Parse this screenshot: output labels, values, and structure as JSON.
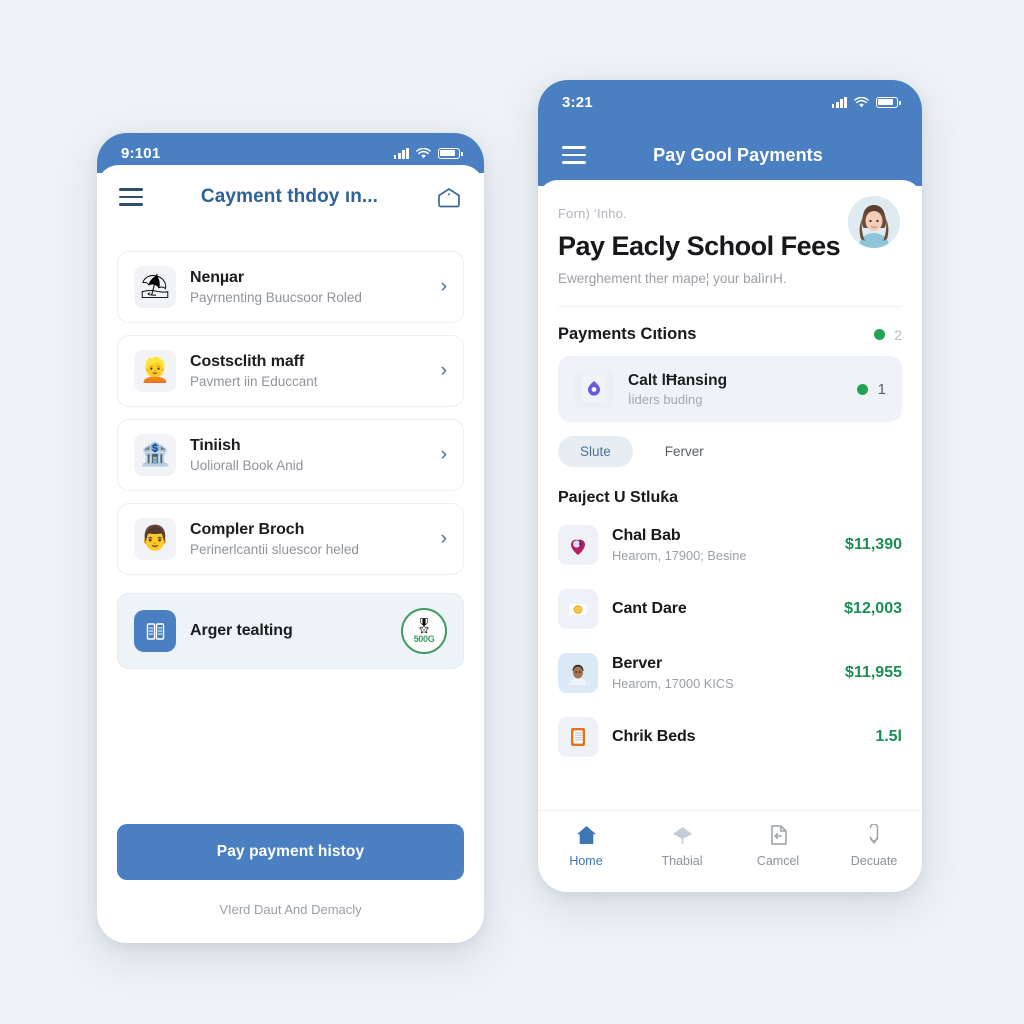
{
  "page": {
    "background": "#eef2f6",
    "accent_blue": "#4a80c2",
    "green": "#1a8f54"
  },
  "left_phone": {
    "status": {
      "time": "9:101",
      "signal_icon": "signal-bars-icon",
      "wifi_icon": "wifi-icon",
      "battery_icon": "battery-icon"
    },
    "appbar": {
      "menu_icon": "hamburger-menu-icon",
      "title": "Cayment thdoy ın...",
      "action_icon": "mail-open-icon"
    },
    "items": [
      {
        "icon": "beach-umbrella-icon",
        "glyph": "⛱",
        "title": "Nenµar",
        "subtitle": "Payrnenting Buucsoor Roled",
        "chevron": "›"
      },
      {
        "icon": "person-orange-icon",
        "glyph": "👱",
        "title": "Costsclith maff",
        "subtitle": "Pavmert iin Educcant",
        "chevron": "›"
      },
      {
        "icon": "bank-building-icon",
        "glyph": "🏦",
        "title": "Tiniish",
        "subtitle": "Uoliorall Book Anid",
        "chevron": "›"
      },
      {
        "icon": "person-avatar-icon",
        "glyph": "👨",
        "title": "Compler Broch",
        "subtitle": "Perinerlcantii sluescor heled",
        "chevron": "›"
      }
    ],
    "highlight_item": {
      "icon": "document-grid-icon",
      "title": "Arger tealting",
      "badge": {
        "icon": "certificate-badge-icon",
        "label": "500G",
        "ring_color": "#3f9b63"
      }
    },
    "cta_label": "Pay payment histoy",
    "footnote": "VIerd Daut And Demacly"
  },
  "right_phone": {
    "status": {
      "time": "3:21",
      "signal_icon": "signal-bars-icon",
      "wifi_icon": "wifi-icon",
      "battery_icon": "battery-icon"
    },
    "appbar": {
      "menu_icon": "hamburger-menu-icon",
      "title": "Pay Gool Payments"
    },
    "hero": {
      "avatar_icon": "user-avatar-photo",
      "eyebrow": "Forn) ‘Inho.",
      "title": "Pay Eacly School Fees",
      "subtitle": "Ewerghement ther mape¦ your balìrıH."
    },
    "section": {
      "title": "Payments Cıtions",
      "status_dot_color": "#23a455",
      "status_value": "2"
    },
    "option_row": {
      "icon": "shield-drop-icon",
      "title": "Calt lĦansing",
      "subtitle": "Ìiders buding",
      "dot_color": "#23a455",
      "value": "1"
    },
    "chips": [
      {
        "label": "Slute",
        "active": true
      },
      {
        "label": "Ferver",
        "active": false
      }
    ],
    "transactions_title": "Paıject U Stluƙa",
    "transactions": [
      {
        "icon": "heart-pin-icon",
        "glyph": "💜",
        "name": "Chal Bab",
        "sub": "Hearom, 17900; Besine",
        "amount": "$11,390"
      },
      {
        "icon": "gold-coin-icon",
        "glyph": "🪙",
        "name": "Cant Dare",
        "sub": "",
        "amount": "$12,003"
      },
      {
        "icon": "person-face-icon",
        "glyph": "👨",
        "name": "Berver",
        "sub": "Hearom, 17000 KICS",
        "amount": "$11,955"
      },
      {
        "icon": "notepad-icon",
        "glyph": "📔",
        "name": "Chrik Beds",
        "sub": "",
        "amount": "1.5l"
      }
    ],
    "tabs": [
      {
        "label": "Home",
        "icon": "home-icon",
        "active": true
      },
      {
        "label": "Thabial",
        "icon": "diamond-icon",
        "active": false
      },
      {
        "label": "Camcel",
        "icon": "file-arrow-icon",
        "active": false
      },
      {
        "label": "Decuate",
        "icon": "attachment-clip-icon",
        "active": false
      }
    ]
  }
}
